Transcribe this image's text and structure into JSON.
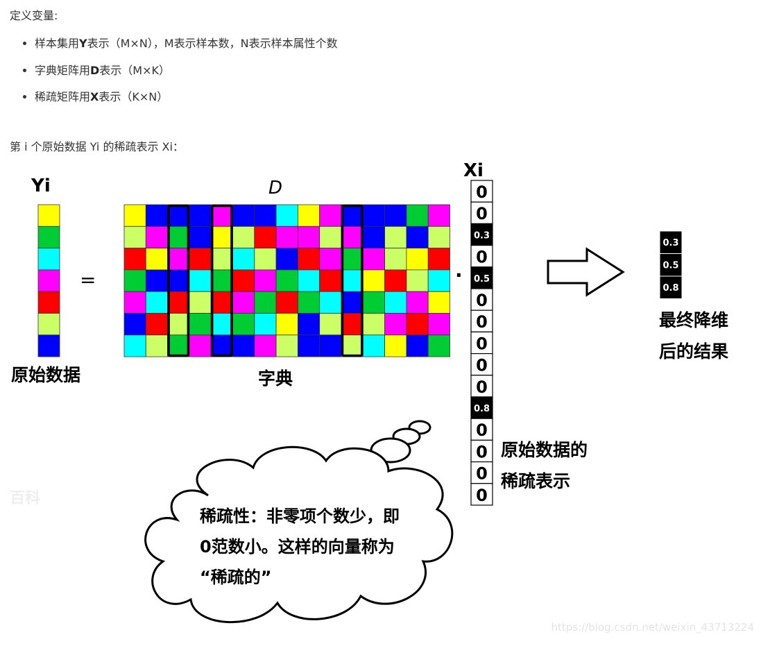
{
  "intro": "定义变量:",
  "bullets": [
    {
      "pre": "样本集用",
      "bold": "Y",
      "post": "表示（M×N），M表示样本数，N表示样本属性个数"
    },
    {
      "pre": "字典矩阵用",
      "bold": "D",
      "post": "表示（M×K）"
    },
    {
      "pre": "稀疏矩阵用",
      "bold": "X",
      "post": "表示（K×N）"
    }
  ],
  "subtitle": "第 i 个原始数据 Yi 的稀疏表示 Xi：",
  "figure": {
    "yi_label": "Yi",
    "d_label": "D",
    "xi_label": "Xi",
    "equals": "=",
    "dot": "·",
    "yi_caption": "原始数据",
    "d_caption": "字典",
    "xi_caption_1": "原始数据的",
    "xi_caption_2": "稀疏表示",
    "result_caption_1": "最终降维",
    "result_caption_2": "后的结果",
    "cloud_line_1": "稀疏性：非零项个数少，即",
    "cloud_line_2": "0范数小。这样的向量称为",
    "cloud_line_3": "“稀疏的”",
    "xi_values": [
      "0",
      "0",
      "0.3",
      "0",
      "0.5",
      "0",
      "0",
      "0",
      "0",
      "0",
      "0.8",
      "0",
      "0",
      "0",
      "0"
    ],
    "result_values": [
      "0.3",
      "0.5",
      "0.8"
    ],
    "yi_colors": [
      "#ffff00",
      "#00cc33",
      "#00ffff",
      "#ff00ff",
      "#ff0000",
      "#ccff66",
      "#0000ff"
    ],
    "d_grid": [
      [
        "#ffff00",
        "#0000ff",
        "#0000ff",
        "#0000ff",
        "#ff00ff",
        "#0000ff",
        "#0000ff",
        "#00ffff",
        "#ffff00",
        "#ff00ff",
        "#0000ff",
        "#0000ff",
        "#0000ff",
        "#00cc33",
        "#ff00ff"
      ],
      [
        "#ccff66",
        "#ff00ff",
        "#00cc33",
        "#0000ff",
        "#ffff00",
        "#ccff66",
        "#ff0000",
        "#ff00ff",
        "#ff00ff",
        "#ccff66",
        "#ff00ff",
        "#0000ff",
        "#ccff66",
        "#0000ff",
        "#ccff66"
      ],
      [
        "#ff0000",
        "#ffff00",
        "#ff00ff",
        "#ff0000",
        "#ccff66",
        "#00ffff",
        "#ccff66",
        "#0000ff",
        "#ff0000",
        "#ff00ff",
        "#00cc33",
        "#ff00ff",
        "#ccff66",
        "#ffff00",
        "#ff0000"
      ],
      [
        "#00cc33",
        "#0000ff",
        "#0000ff",
        "#00ffff",
        "#00cc33",
        "#ff0000",
        "#ff00ff",
        "#00cc33",
        "#00ffff",
        "#ff0000",
        "#00ffff",
        "#ffff00",
        "#ff0000",
        "#ccff66",
        "#00ffff"
      ],
      [
        "#ff00ff",
        "#00ffff",
        "#ff0000",
        "#ccff66",
        "#ff0000",
        "#ff00ff",
        "#00cc33",
        "#ff0000",
        "#00cc33",
        "#00ffff",
        "#0000ff",
        "#00cc33",
        "#00ffff",
        "#ff00ff",
        "#ffff00"
      ],
      [
        "#0000ff",
        "#ff0000",
        "#ccff66",
        "#00cc33",
        "#00ffff",
        "#00cc33",
        "#00ffff",
        "#ffff00",
        "#0000ff",
        "#ccff66",
        "#ff0000",
        "#ccff66",
        "#ff00ff",
        "#ff0000",
        "#ff00ff"
      ],
      [
        "#00ffff",
        "#ccff66",
        "#00cc33",
        "#ff00ff",
        "#0000ff",
        "#0000ff",
        "#ff00ff",
        "#ccff66",
        "#0000ff",
        "#0000ff",
        "#ccff66",
        "#00ffff",
        "#ffff00",
        "#0000ff",
        "#00cc33"
      ]
    ],
    "highlight_columns": [
      2,
      4,
      10
    ]
  },
  "watermark": "https://blog.csdn.net/weixin_43713224",
  "logo_mark": "百科"
}
